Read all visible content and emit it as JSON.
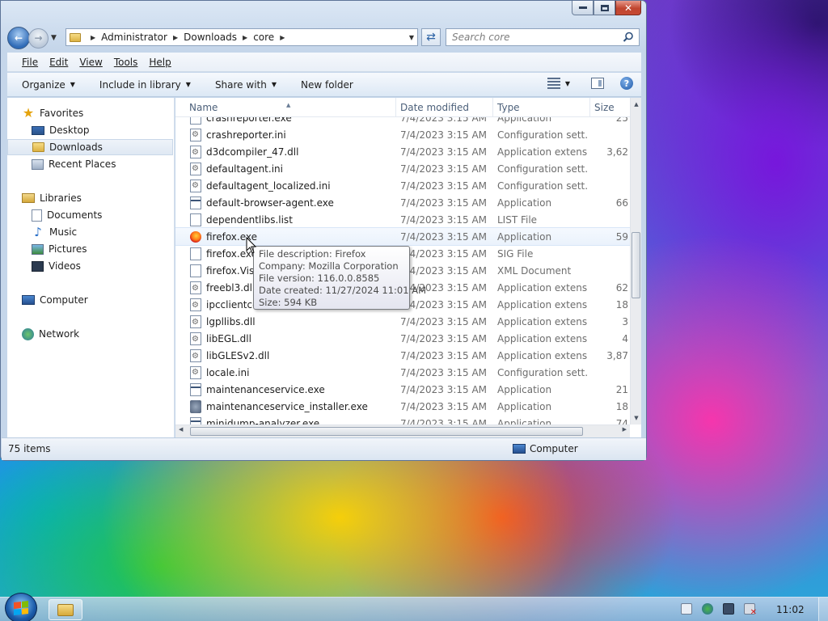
{
  "address": {
    "crumbs": [
      "Administrator",
      "Downloads",
      "core"
    ]
  },
  "search": {
    "placeholder": "Search core"
  },
  "menu": [
    "File",
    "Edit",
    "View",
    "Tools",
    "Help"
  ],
  "commands": {
    "organize": "Organize",
    "include_in_library": "Include in library",
    "share_with": "Share with",
    "new_folder": "New folder"
  },
  "navpane": {
    "favorites": "Favorites",
    "desktop": "Desktop",
    "downloads": "Downloads",
    "recent_places": "Recent Places",
    "libraries": "Libraries",
    "documents": "Documents",
    "music": "Music",
    "pictures": "Pictures",
    "videos": "Videos",
    "computer": "Computer",
    "network": "Network"
  },
  "columns": {
    "name": "Name",
    "date": "Date modified",
    "type": "Type",
    "size": "Size"
  },
  "files": [
    {
      "name": "crashreporter.exe",
      "date": "7/4/2023 3:15 AM",
      "type": "Application",
      "size": "25",
      "icon": "app"
    },
    {
      "name": "crashreporter.ini",
      "date": "7/4/2023 3:15 AM",
      "type": "Configuration sett...",
      "size": "",
      "icon": "cfg"
    },
    {
      "name": "d3dcompiler_47.dll",
      "date": "7/4/2023 3:15 AM",
      "type": "Application extens...",
      "size": "3,62",
      "icon": "dll"
    },
    {
      "name": "defaultagent.ini",
      "date": "7/4/2023 3:15 AM",
      "type": "Configuration sett...",
      "size": "",
      "icon": "cfg"
    },
    {
      "name": "defaultagent_localized.ini",
      "date": "7/4/2023 3:15 AM",
      "type": "Configuration sett...",
      "size": "",
      "icon": "cfg"
    },
    {
      "name": "default-browser-agent.exe",
      "date": "7/4/2023 3:15 AM",
      "type": "Application",
      "size": "66",
      "icon": "app"
    },
    {
      "name": "dependentlibs.list",
      "date": "7/4/2023 3:15 AM",
      "type": "LIST File",
      "size": "",
      "icon": "blank"
    },
    {
      "name": "firefox.exe",
      "date": "7/4/2023 3:15 AM",
      "type": "Application",
      "size": "59",
      "icon": "fx"
    },
    {
      "name": "firefox.exe.sig",
      "date": "7/4/2023 3:15 AM",
      "type": "SIG File",
      "size": "",
      "icon": "blank"
    },
    {
      "name": "firefox.VisualElementsManifest.xml",
      "date": "7/4/2023 3:15 AM",
      "type": "XML Document",
      "size": "",
      "icon": "blank"
    },
    {
      "name": "freebl3.dll",
      "date": "7/4/2023 3:15 AM",
      "type": "Application extens...",
      "size": "62",
      "icon": "dll"
    },
    {
      "name": "ipcclientcerts.dll",
      "date": "7/4/2023 3:15 AM",
      "type": "Application extens...",
      "size": "18",
      "icon": "dll"
    },
    {
      "name": "lgpllibs.dll",
      "date": "7/4/2023 3:15 AM",
      "type": "Application extens...",
      "size": "3",
      "icon": "dll"
    },
    {
      "name": "libEGL.dll",
      "date": "7/4/2023 3:15 AM",
      "type": "Application extens...",
      "size": "4",
      "icon": "dll"
    },
    {
      "name": "libGLESv2.dll",
      "date": "7/4/2023 3:15 AM",
      "type": "Application extens...",
      "size": "3,87",
      "icon": "dll"
    },
    {
      "name": "locale.ini",
      "date": "7/4/2023 3:15 AM",
      "type": "Configuration sett...",
      "size": "",
      "icon": "cfg"
    },
    {
      "name": "maintenanceservice.exe",
      "date": "7/4/2023 3:15 AM",
      "type": "Application",
      "size": "21",
      "icon": "app"
    },
    {
      "name": "maintenanceservice_installer.exe",
      "date": "7/4/2023 3:15 AM",
      "type": "Application",
      "size": "18",
      "icon": "inst"
    },
    {
      "name": "minidump-analyzer.exe",
      "date": "7/4/2023 3:15 AM",
      "type": "Application",
      "size": "74",
      "icon": "app"
    }
  ],
  "tooltip": {
    "description": "File description: Firefox",
    "company": "Company: Mozilla Corporation",
    "version": "File version: 116.0.0.8585",
    "created": "Date created: 11/27/2024 11:01 AM",
    "size": "Size: 594 KB"
  },
  "status": {
    "items": "75 items",
    "location": "Computer"
  },
  "taskbar": {
    "clock": "11:02"
  }
}
